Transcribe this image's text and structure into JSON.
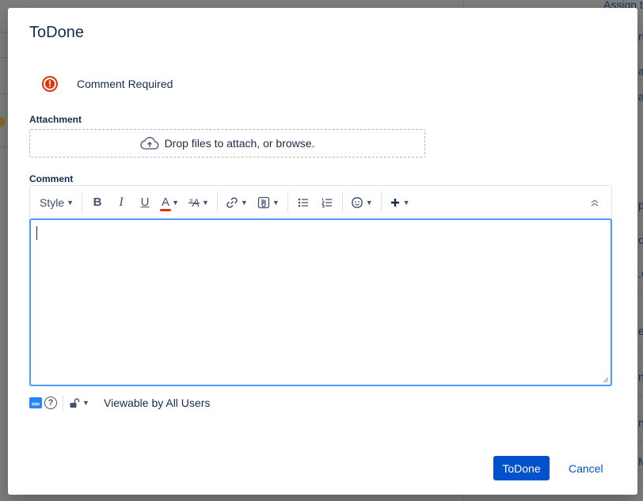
{
  "background": {
    "links": [
      "Assign t",
      "ru",
      "a",
      "a",
      "p",
      "o",
      ".C",
      "e",
      "n",
      "n",
      "M"
    ]
  },
  "dialog": {
    "title": "ToDone",
    "message": "Comment Required",
    "attachment": {
      "label": "Attachment",
      "dropzone_text": "Drop files to attach, or browse."
    },
    "comment": {
      "label": "Comment",
      "value": ""
    },
    "toolbar": {
      "style_label": "Style",
      "bold": "B",
      "italic": "I",
      "underline": "U",
      "text_color": "A",
      "text_effects": "³A"
    },
    "visibility": "Viewable by All Users",
    "actions": {
      "submit": "ToDone",
      "cancel": "Cancel"
    }
  },
  "colors": {
    "primary": "#0052cc",
    "error": "#de350b",
    "focus_border": "#4c9aff"
  }
}
